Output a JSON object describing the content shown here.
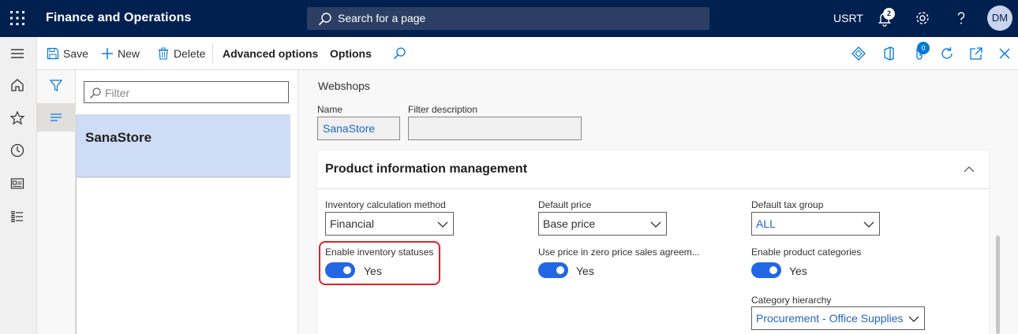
{
  "topbar": {
    "app_title": "Finance and Operations",
    "search_placeholder": "Search for a page",
    "company": "USRT",
    "notification_count": "2",
    "avatar_initials": "DM"
  },
  "actionpane": {
    "save": "Save",
    "new": "New",
    "delete": "Delete",
    "advanced_options": "Advanced options",
    "options": "Options",
    "attachments_count": "0"
  },
  "listpane": {
    "filter_placeholder": "Filter",
    "items": [
      {
        "label": "SanaStore"
      }
    ]
  },
  "details": {
    "title": "Webshops",
    "name_label": "Name",
    "name_value": "SanaStore",
    "filter_desc_label": "Filter description",
    "filter_desc_value": "",
    "card": {
      "title": "Product information management",
      "inventory_calc_label": "Inventory calculation method",
      "inventory_calc_value": "Financial",
      "default_price_label": "Default price",
      "default_price_value": "Base price",
      "default_tax_label": "Default tax group",
      "default_tax_value": "ALL",
      "enable_inv_status_label": "Enable inventory statuses",
      "enable_inv_status_value": "Yes",
      "zero_price_label": "Use price in zero price sales agreem...",
      "zero_price_value": "Yes",
      "enable_categories_label": "Enable product categories",
      "enable_categories_value": "Yes",
      "category_hierarchy_label": "Category hierarchy",
      "category_hierarchy_value": "Procurement - Office Supplies"
    }
  },
  "colors": {
    "topbar_bg": "#002050",
    "accent": "#2266e3",
    "selected_row": "#cfdcf6",
    "highlight": "#e0202a"
  }
}
